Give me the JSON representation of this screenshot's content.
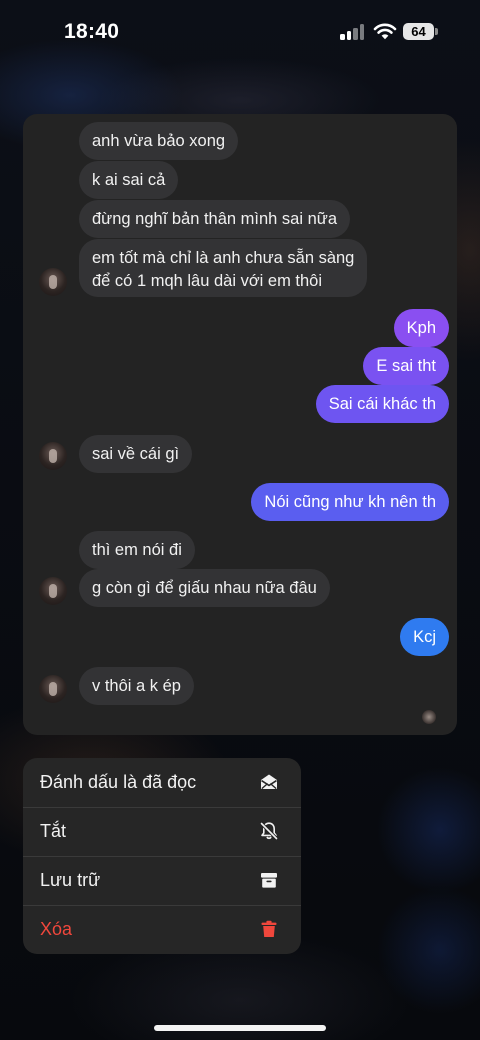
{
  "status_bar": {
    "time": "18:40",
    "battery": "64"
  },
  "chat": {
    "messages": [
      {
        "dir": "in",
        "text": "anh vừa bảo xong"
      },
      {
        "dir": "in",
        "text": "k ai sai cả"
      },
      {
        "dir": "in",
        "text": "đừng nghĩ bản thân mình sai nữa"
      },
      {
        "dir": "in",
        "text": "em tốt mà chỉ là anh chưa sẵn sàng",
        "text2": "để có 1 mqh lâu dài với em thôi"
      },
      {
        "dir": "out",
        "text": "Kph"
      },
      {
        "dir": "out",
        "text": "E sai tht"
      },
      {
        "dir": "out",
        "text": "Sai cái khác th"
      },
      {
        "dir": "in",
        "text": "sai về cái gì"
      },
      {
        "dir": "out",
        "text": "Nói cũng như kh nên th"
      },
      {
        "dir": "in",
        "text": "thì em nói đi"
      },
      {
        "dir": "in",
        "text": "g còn gì để giấu nhau nữa đâu"
      },
      {
        "dir": "out",
        "text": "Kcj"
      },
      {
        "dir": "in",
        "text": "v thôi a k ép"
      }
    ]
  },
  "menu": {
    "items": [
      {
        "label": "Đánh dấu là đã đọc",
        "icon": "envelope-open-icon"
      },
      {
        "label": "Tắt",
        "icon": "bell-slash-icon"
      },
      {
        "label": "Lưu trữ",
        "icon": "archive-box-icon"
      },
      {
        "label": "Xóa",
        "icon": "trash-icon"
      }
    ]
  },
  "colors": {
    "outgoing_top": "#8a4ff1",
    "outgoing_mid": "#5a5ef0",
    "outgoing_bottom": "#2f7bf0",
    "incoming": "#333335",
    "danger": "#f0473c"
  }
}
